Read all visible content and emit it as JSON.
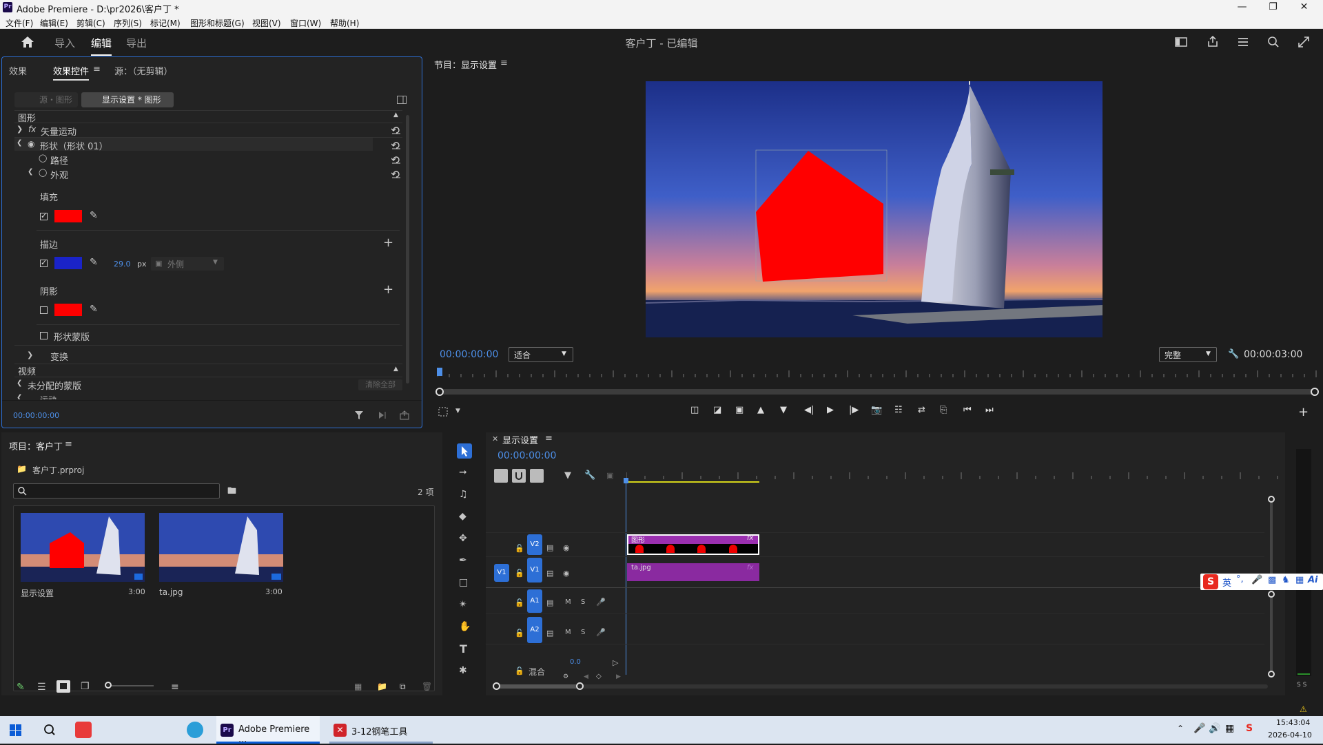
{
  "window": {
    "app_logo": "Pr",
    "title": "Adobe Premiere - D:\\pr2026\\客户丁 *"
  },
  "menu": [
    "文件(F)",
    "编辑(E)",
    "剪辑(C)",
    "序列(S)",
    "标记(M)",
    "图形和标题(G)",
    "视图(V)",
    "窗口(W)",
    "帮助(H)"
  ],
  "header": {
    "nav": [
      "导入",
      "编辑",
      "导出"
    ],
    "active": "编辑",
    "project_title": "客户丁 - 已编辑"
  },
  "effects_panel": {
    "tabs": [
      "效果",
      "效果控件",
      "源：（无剪辑）"
    ],
    "source_chip": "源・图形",
    "seq_chip": "显示设置 * 图形",
    "section_graphics": "图形",
    "vector_motion": "矢量运动",
    "shape_label": "形状（形状 01）",
    "path_label": "路径",
    "appearance_label": "外观",
    "fill_label": "填充",
    "fill_color": "#ff0000",
    "stroke_label": "描边",
    "stroke_color": "#1a23c8",
    "stroke_width": "29.0",
    "stroke_unit": "px",
    "stroke_position": "外侧",
    "shadow_label": "阴影",
    "shadow_color": "#ff0000",
    "shape_mask_label": "形状蒙版",
    "transform_label": "变换",
    "section_video": "视频",
    "unassigned_mask": "未分配的蒙版",
    "clear_all": "清除全部",
    "motion_label": "运动",
    "timecode": "00:00:00:00"
  },
  "program_monitor": {
    "title": "节目：显示设置",
    "timecode_left": "00:00:00:00",
    "fit": "适合",
    "quality": "完整",
    "duration": "00:00:03:00",
    "shape_color": "#ff0000"
  },
  "project_panel": {
    "title": "项目：客户丁",
    "file": "客户丁.prproj",
    "search_placeholder": "",
    "item_count": "2 项",
    "items": [
      {
        "name": "显示设置",
        "duration": "3:00"
      },
      {
        "name": "ta.jpg",
        "duration": "3:00"
      }
    ]
  },
  "timeline": {
    "tab": "显示设置",
    "timecode": "00:00:00:00",
    "tracks": [
      {
        "name": "V2",
        "type": "video"
      },
      {
        "name": "V1",
        "type": "video",
        "source": "V1"
      },
      {
        "name": "A1",
        "type": "audio",
        "m": "M",
        "s": "S"
      },
      {
        "name": "A2",
        "type": "audio",
        "m": "M",
        "s": "S"
      }
    ],
    "mix_label": "混合",
    "mix_value": "0.0",
    "clips": [
      {
        "track": "V2",
        "label": "图形",
        "fx": "fx",
        "color": "#9b2fb0"
      },
      {
        "track": "V1",
        "label": "ta.jpg",
        "fx": "fx",
        "color": "#8a2aa0"
      }
    ],
    "meter_labels": "S S"
  },
  "ime": {
    "logo": "S",
    "mode": "英",
    "ai": "Ai"
  },
  "taskbar": {
    "apps": [
      {
        "label": "Adobe Premiere ...",
        "active": true
      },
      {
        "label": "3-12钢笔工具",
        "active": false
      }
    ],
    "time": "15:43:04",
    "date": "2026-04-10"
  },
  "colors": {
    "accent": "#4d8fe8",
    "selection": "#2d6fd6",
    "clip_purple": "#9b2fb0"
  }
}
